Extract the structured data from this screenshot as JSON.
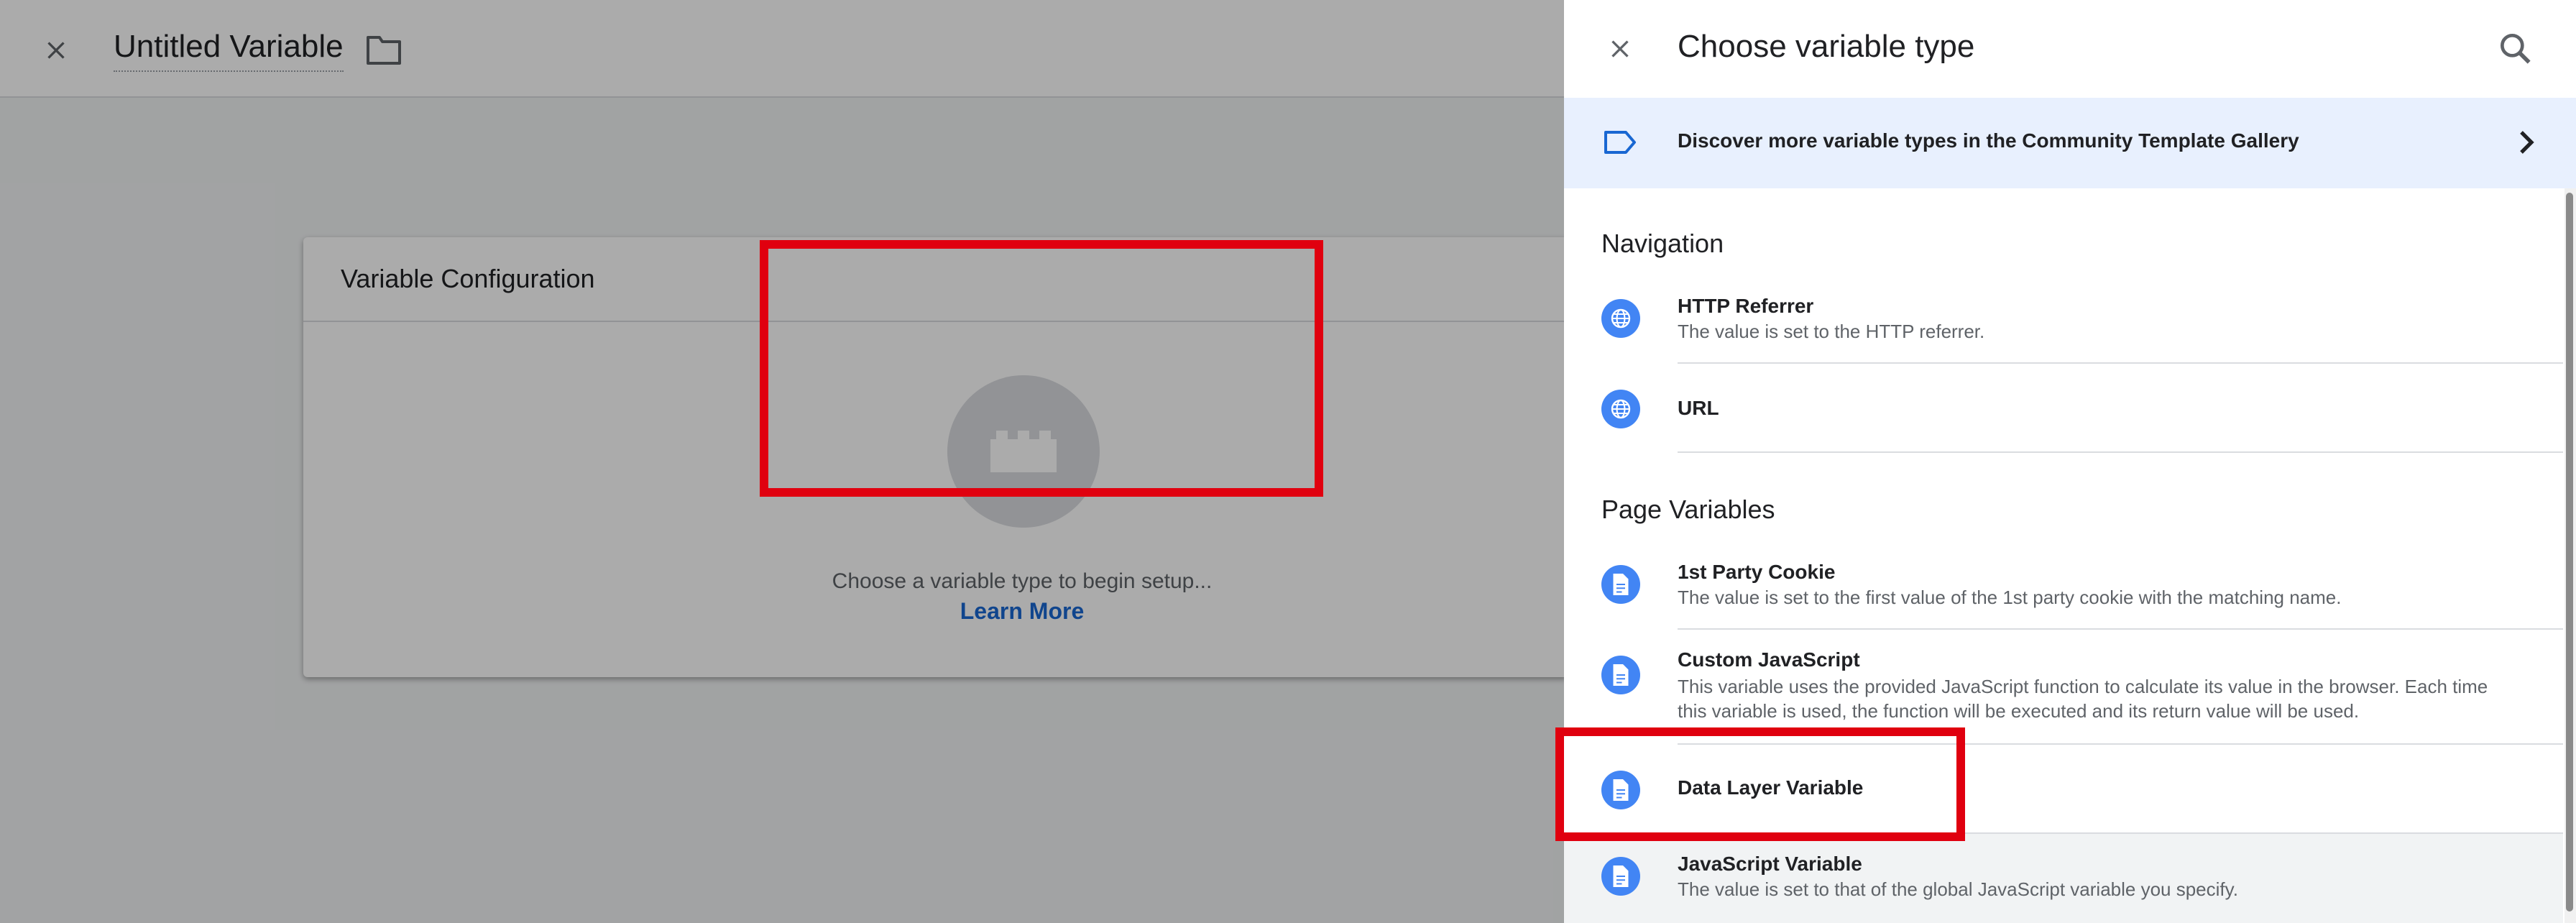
{
  "editor": {
    "title": "Untitled Variable",
    "card_title": "Variable Configuration",
    "placeholder_text": "Choose a variable type to begin setup...",
    "learn_more": "Learn More"
  },
  "panel": {
    "title": "Choose variable type",
    "gallery_text": "Discover more variable types in the Community Template Gallery",
    "sections": [
      {
        "title": "Navigation",
        "items": [
          {
            "name": "HTTP Referrer",
            "desc": "The value is set to the HTTP referrer.",
            "icon": "globe-icon"
          },
          {
            "name": "URL",
            "desc": "",
            "icon": "globe-icon"
          }
        ]
      },
      {
        "title": "Page Variables",
        "items": [
          {
            "name": "1st Party Cookie",
            "desc": "The value is set to the first value of the 1st party cookie with the matching name.",
            "icon": "document-icon"
          },
          {
            "name": "Custom JavaScript",
            "desc": "This variable uses the provided JavaScript function to calculate its value in the browser. Each time this variable is used, the function will be executed and its return value will be used.",
            "icon": "document-icon"
          },
          {
            "name": "Data Layer Variable",
            "desc": "",
            "icon": "document-icon"
          },
          {
            "name": "JavaScript Variable",
            "desc": "The value is set to that of the global JavaScript variable you specify.",
            "icon": "document-icon"
          }
        ]
      }
    ]
  },
  "colors": {
    "accent": "#1967d2",
    "icon_bg": "#4285f4",
    "highlight": "#e0000f",
    "banner_bg": "#e8f0fe"
  }
}
